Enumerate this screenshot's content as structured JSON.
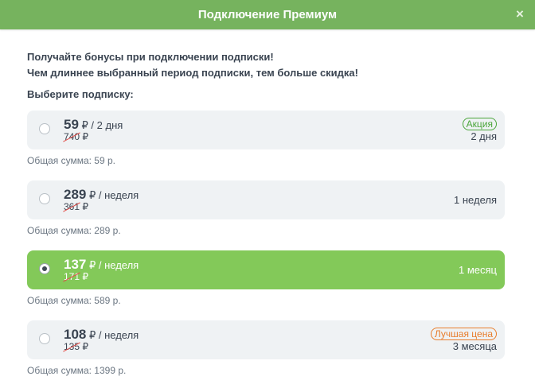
{
  "header": {
    "title": "Подключение Премиум",
    "close_label": "×"
  },
  "intro": {
    "line1": "Получайте бонусы при подключении подписки!",
    "line2": "Чем длиннее выбранный период подписки, тем больше скидка!"
  },
  "choose_label": "Выберите подписку:",
  "plans": [
    {
      "price": "59",
      "unit": " ₽ / 2 дня",
      "old_price": "740",
      "old_currency": " ₽",
      "badge": "Акция",
      "duration": "2 дня",
      "total": "Общая сумма: 59 р.",
      "selected": false
    },
    {
      "price": "289",
      "unit": " ₽ / неделя",
      "old_price": "361",
      "old_currency": " ₽",
      "badge": "",
      "duration": "1 неделя",
      "total": "Общая сумма: 289 р.",
      "selected": false
    },
    {
      "price": "137",
      "unit": " ₽ / неделя",
      "old_price": "171",
      "old_currency": " ₽",
      "badge": "",
      "duration": "1 месяц",
      "total": "Общая сумма: 589 р.",
      "selected": true
    },
    {
      "price": "108",
      "unit": " ₽ / неделя",
      "old_price": "135",
      "old_currency": " ₽",
      "badge": "Лучшая цена",
      "duration": "3 месяца",
      "total": "Общая сумма: 1399 р.",
      "selected": false
    }
  ],
  "colors": {
    "header_bg": "#76b35e",
    "selected_bg": "#83c959",
    "card_bg": "#eff2f4",
    "badge_green": "#4aa53a",
    "badge_orange": "#e87d2c",
    "strike_red": "#e0504c"
  },
  "icons": {
    "close": "close-icon"
  }
}
